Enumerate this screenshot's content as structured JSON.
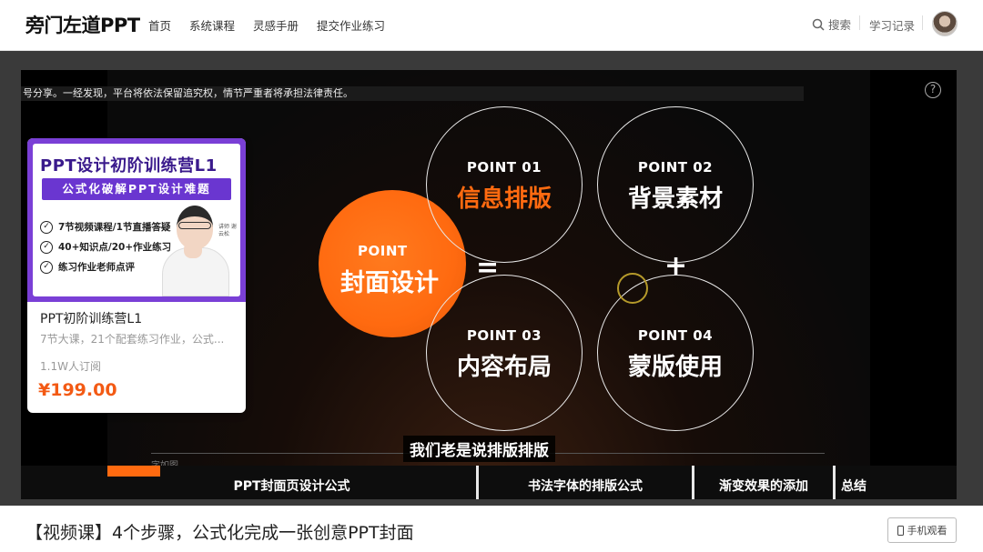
{
  "header": {
    "logo": "旁门左道PPT",
    "nav": [
      "首页",
      "系统课程",
      "灵感手册",
      "提交作业练习"
    ],
    "search_label": "搜索",
    "record_label": "学习记录"
  },
  "video": {
    "notice": "号分享。一经发现，平台将依法保留追究权，情节严重者将承担法律责任。",
    "help_label": "?",
    "slide": {
      "center_point": "POINT",
      "center_title": "封面设计",
      "equals": "=",
      "plus": "+",
      "points": [
        {
          "label": "POINT 01",
          "name": "信息排版"
        },
        {
          "label": "POINT 02",
          "name": "背景素材"
        },
        {
          "label": "POINT 03",
          "name": "内容布局"
        },
        {
          "label": "POINT 04",
          "name": "蒙版使用"
        }
      ],
      "faint_text": "字如图"
    },
    "subtitle": "我们老是说排版排版",
    "chapters": [
      "PPT封面页设计公式",
      "书法字体的排版公式",
      "渐变效果的添加",
      "总结"
    ],
    "colors": {
      "accent": "#ff6a10"
    }
  },
  "course_card": {
    "cover_title": "PPT设计初阶训练营L1",
    "cover_subtitle": "公式化破解PPT设计难题",
    "cover_items": [
      "7节视频课程/1节直播答疑",
      "40+知识点/20+作业练习",
      "练习作业老师点评"
    ],
    "teacher_label": "讲师 谢云松",
    "name": "PPT初阶训练营L1",
    "description": "7节大课，21个配套练习作业，公式...",
    "subscribers": "1.1W人订阅",
    "price": "¥199.00"
  },
  "footer": {
    "title": "【视频课】4个步骤，公式化完成一张创意PPT封面",
    "mobile_button": "手机观看"
  }
}
